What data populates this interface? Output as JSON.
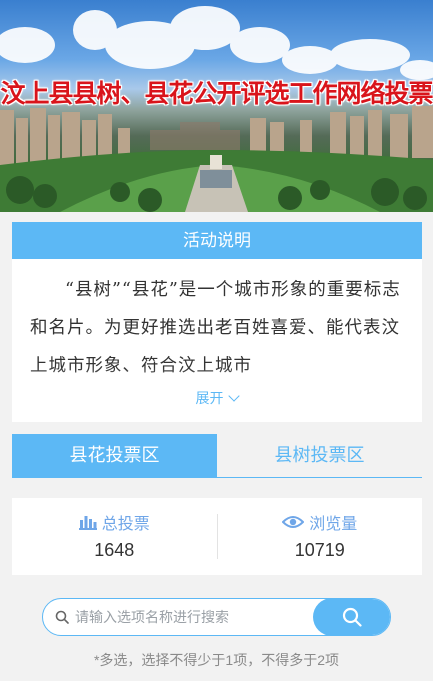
{
  "banner": {
    "title": "汶上县县树、县花公开评选工作网络投票"
  },
  "description": {
    "header": "活动说明",
    "text": "“县树”“县花”是一个城市形象的重要标志和名片。为更好推选出老百姓喜爱、能代表汶上城市形象、符合汶上城市",
    "expand_label": "展开"
  },
  "tabs": [
    {
      "label": "县花投票区",
      "active": true
    },
    {
      "label": "县树投票区",
      "active": false
    }
  ],
  "stats": {
    "total_votes_label": "总投票",
    "total_votes_value": "1648",
    "views_label": "浏览量",
    "views_value": "10719"
  },
  "search": {
    "placeholder": "请输入选项名称进行搜索",
    "value": ""
  },
  "rule_text": "*多选，选择不得少于1项，不得多于2项",
  "colors": {
    "accent": "#5cb8f5",
    "title_red": "#d9141b",
    "stat_blue": "#6fa6e8"
  }
}
